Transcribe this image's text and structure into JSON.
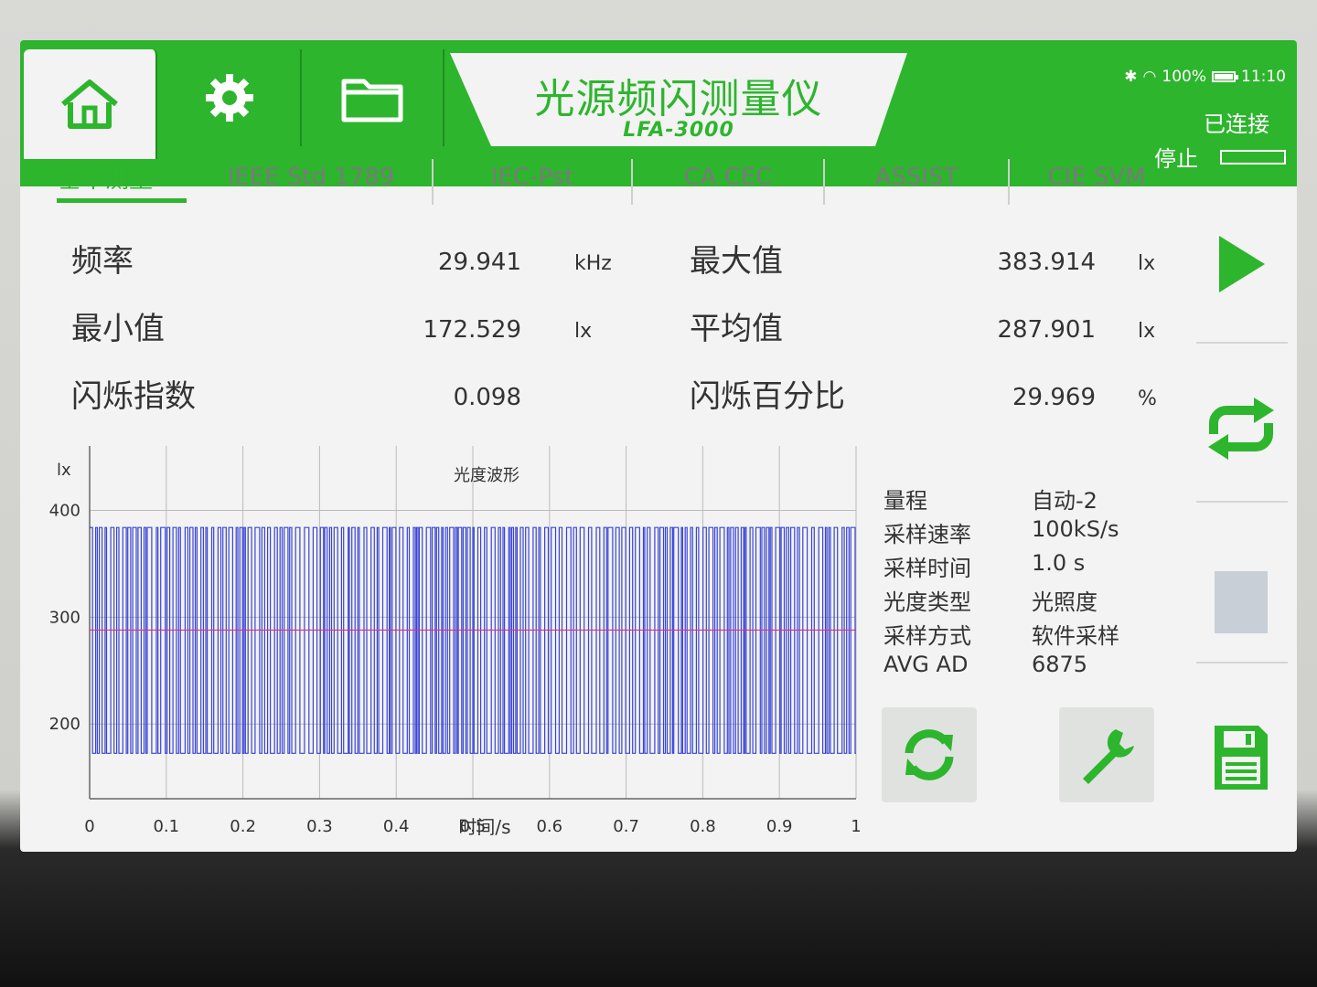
{
  "header": {
    "title": "光源频闪测量仪",
    "model": "LFA-3000",
    "status": {
      "battery": "100%",
      "time": "11:10"
    },
    "connection": "已连接",
    "stop_label": "停止"
  },
  "tabs": [
    {
      "label": "基本测量",
      "active": true
    },
    {
      "label": "IEEE Std 1789",
      "active": false
    },
    {
      "label": "IEC-Pst",
      "active": false
    },
    {
      "label": "CA CEC",
      "active": false
    },
    {
      "label": "ASSIST",
      "active": false
    },
    {
      "label": "CIE SVM",
      "active": false
    }
  ],
  "measurements": {
    "left": [
      {
        "label": "频率",
        "value": "29.941",
        "unit": "kHz"
      },
      {
        "label": "最小值",
        "value": "172.529",
        "unit": "lx"
      },
      {
        "label": "闪烁指数",
        "value": "0.098",
        "unit": ""
      }
    ],
    "right": [
      {
        "label": "最大值",
        "value": "383.914",
        "unit": "lx"
      },
      {
        "label": "平均值",
        "value": "287.901",
        "unit": "lx"
      },
      {
        "label": "闪烁百分比",
        "value": "29.969",
        "unit": "%"
      }
    ]
  },
  "info": [
    {
      "label": "量程",
      "value": "自动-2"
    },
    {
      "label": "采样速率",
      "value": "100kS/s"
    },
    {
      "label": "采样时间",
      "value": "1.0 s"
    },
    {
      "label": "光度类型",
      "value": "光照度"
    },
    {
      "label": "采样方式",
      "value": "软件采样"
    },
    {
      "label": "AVG AD",
      "value": "6875"
    }
  ],
  "colors": {
    "accent": "#2db52d",
    "waveform": "#3a44d6",
    "average": "#e0307a"
  },
  "chart_data": {
    "type": "line",
    "title": "光度波形",
    "xlabel": "时间/s",
    "ylabel": "lx",
    "xlim": [
      0,
      1
    ],
    "ylim": [
      130,
      450
    ],
    "xticks": [
      "0",
      "0.1",
      "0.2",
      "0.3",
      "0.4",
      "0.5",
      "0.6",
      "0.7",
      "0.8",
      "0.9",
      "1"
    ],
    "yticks": [
      "400",
      "300",
      "200"
    ],
    "series": [
      {
        "values_description": "square wave",
        "low": 172.529,
        "high": 383.914
      }
    ],
    "average_line": 287.901
  }
}
